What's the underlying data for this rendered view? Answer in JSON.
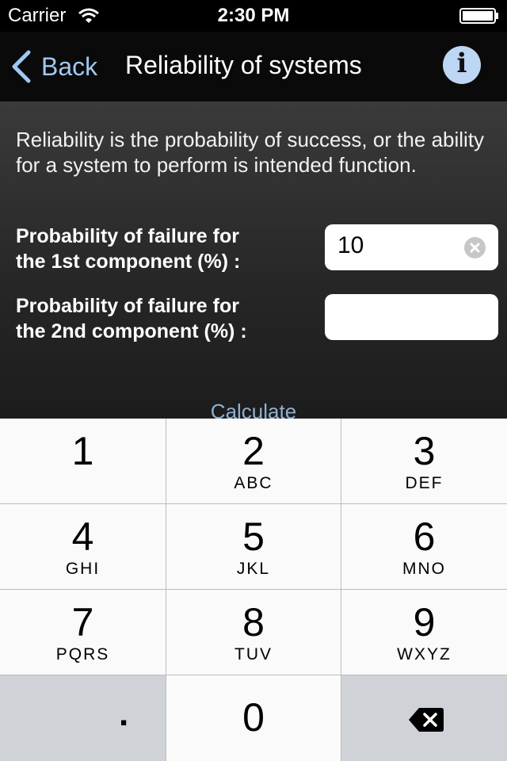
{
  "status_bar": {
    "carrier": "Carrier",
    "time": "2:30 PM"
  },
  "nav": {
    "back_label": "Back",
    "title": "Reliability of systems",
    "info_glyph": "i"
  },
  "content": {
    "description": "Reliability is the probability of success, or the ability for a system to perform is intended function.",
    "field1": {
      "label_line1": "Probability of failure for",
      "label_line2": "the 1st component (%) :",
      "value": "10"
    },
    "field2": {
      "label_line1": "Probability of failure for",
      "label_line2": "the 2nd component (%) :",
      "value": ""
    },
    "calculate_label": "Calculate"
  },
  "keypad": {
    "keys": [
      {
        "num": "1",
        "letters": ""
      },
      {
        "num": "2",
        "letters": "ABC"
      },
      {
        "num": "3",
        "letters": "DEF"
      },
      {
        "num": "4",
        "letters": "GHI"
      },
      {
        "num": "5",
        "letters": "JKL"
      },
      {
        "num": "6",
        "letters": "MNO"
      },
      {
        "num": "7",
        "letters": "PQRS"
      },
      {
        "num": "8",
        "letters": "TUV"
      },
      {
        "num": "9",
        "letters": "WXYZ"
      },
      {
        "num": "0",
        "letters": ""
      }
    ],
    "decimal": ".",
    "backspace_icon": "backspace-icon"
  },
  "colors": {
    "accent": "#9fc8f2",
    "info_button": "#bcd6f3",
    "calculate": "#8fb0d0"
  }
}
